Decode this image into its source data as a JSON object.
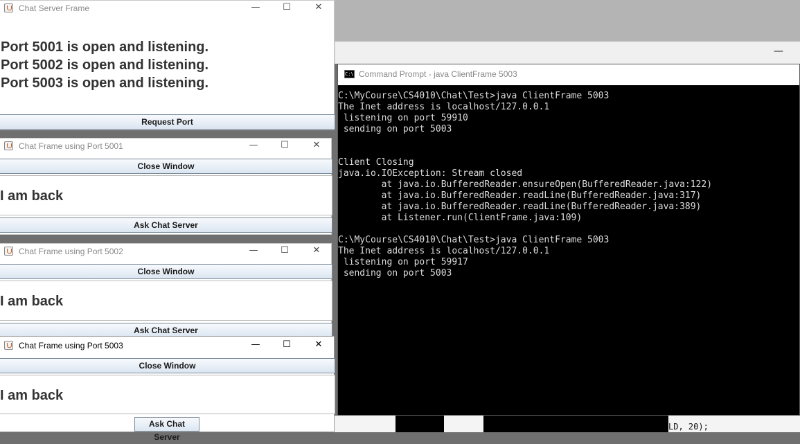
{
  "server": {
    "title": "Chat Server Frame",
    "lines": [
      "Port 5001 is open and listening.",
      "Port 5002 is open and listening.",
      "Port 5003 is open and listening."
    ],
    "request_btn": "Request Port"
  },
  "frames": [
    {
      "title": "Chat Frame using Port 5001",
      "close_btn": "Close Window",
      "message": "I am back",
      "ask_btn": "Ask Chat Server"
    },
    {
      "title": "Chat Frame using Port 5002",
      "close_btn": "Close Window",
      "message": "I am back",
      "ask_btn": "Ask Chat Server"
    },
    {
      "title": "Chat Frame using Port 5003",
      "close_btn": "Close Window",
      "message": "I am back",
      "ask_btn": "Ask Chat Server"
    }
  ],
  "controls": {
    "minimize": "—",
    "maximize": "☐",
    "close": "✕"
  },
  "cmd": {
    "title": "Command Prompt - java  ClientFrame 5003",
    "icon_text": "C:\\",
    "output": "C:\\MyCourse\\CS4010\\Chat\\Test>java ClientFrame 5003\nThe Inet address is localhost/127.0.0.1\n listening on port 59910\n sending on port 5003\n\n\nClient Closing\njava.io.IOException: Stream closed\n        at java.io.BufferedReader.ensureOpen(BufferedReader.java:122)\n        at java.io.BufferedReader.readLine(BufferedReader.java:317)\n        at java.io.BufferedReader.readLine(BufferedReader.java:389)\n        at Listener.run(ClientFrame.java:109)\n\nC:\\MyCourse\\CS4010\\Chat\\Test>java ClientFrame 5003\nThe Inet address is localhost/127.0.0.1\n listening on port 59917\n sending on port 5003"
  },
  "background": {
    "minimize": "—",
    "code_fragment": "LD, 20);"
  }
}
